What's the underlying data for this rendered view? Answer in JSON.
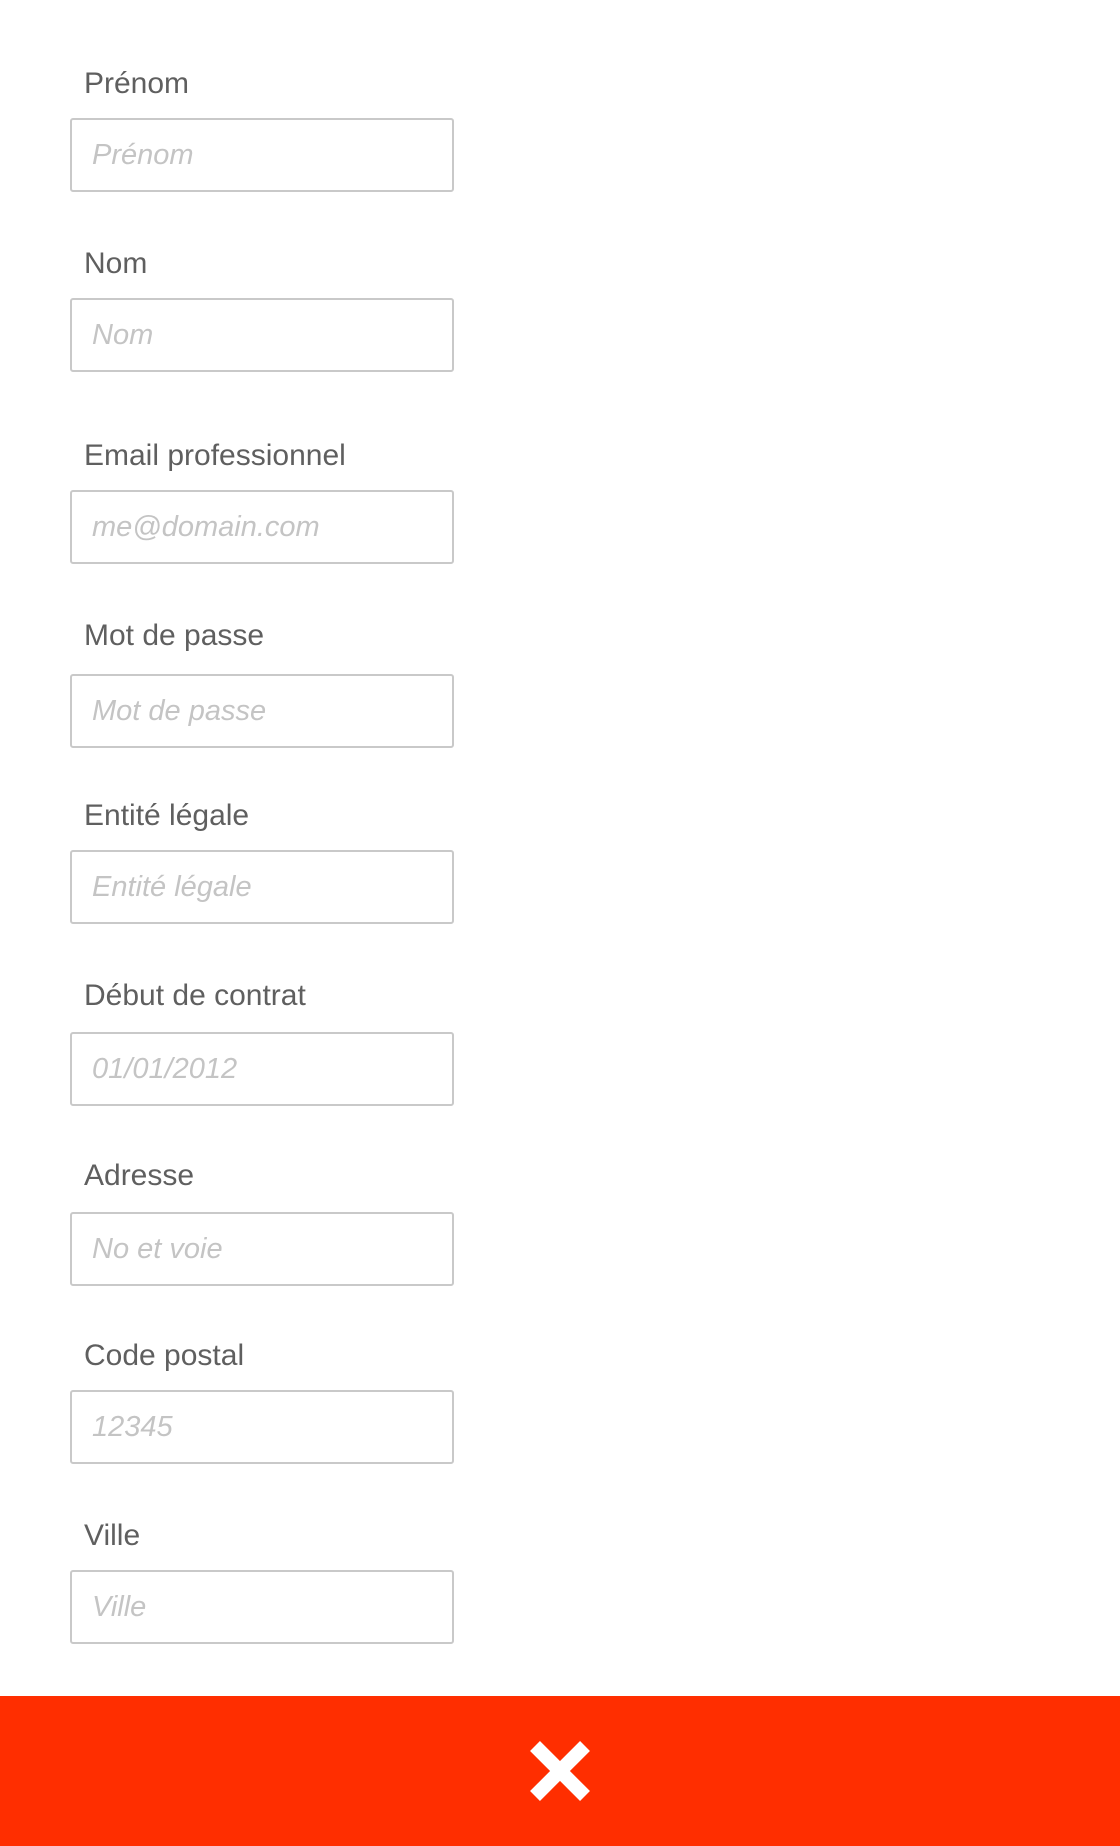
{
  "form": {
    "fields": [
      {
        "label": "Prénom",
        "placeholder": "Prénom",
        "value": ""
      },
      {
        "label": "Nom",
        "placeholder": "Nom",
        "value": ""
      },
      {
        "label": "Email professionnel",
        "placeholder": "me@domain.com",
        "value": ""
      },
      {
        "label": "Mot de passe",
        "placeholder": "Mot de passe",
        "value": ""
      },
      {
        "label": "Entité légale",
        "placeholder": "Entité légale",
        "value": ""
      },
      {
        "label": "Début de contrat",
        "placeholder": "01/01/2012",
        "value": ""
      },
      {
        "label": "Adresse",
        "placeholder": "No et voie",
        "value": ""
      },
      {
        "label": "Code postal",
        "placeholder": "12345",
        "value": ""
      },
      {
        "label": "Ville",
        "placeholder": "Ville",
        "value": ""
      }
    ]
  },
  "footer": {
    "icon": "close-icon",
    "background_color": "#ff2e00",
    "icon_color": "#ffffff"
  }
}
